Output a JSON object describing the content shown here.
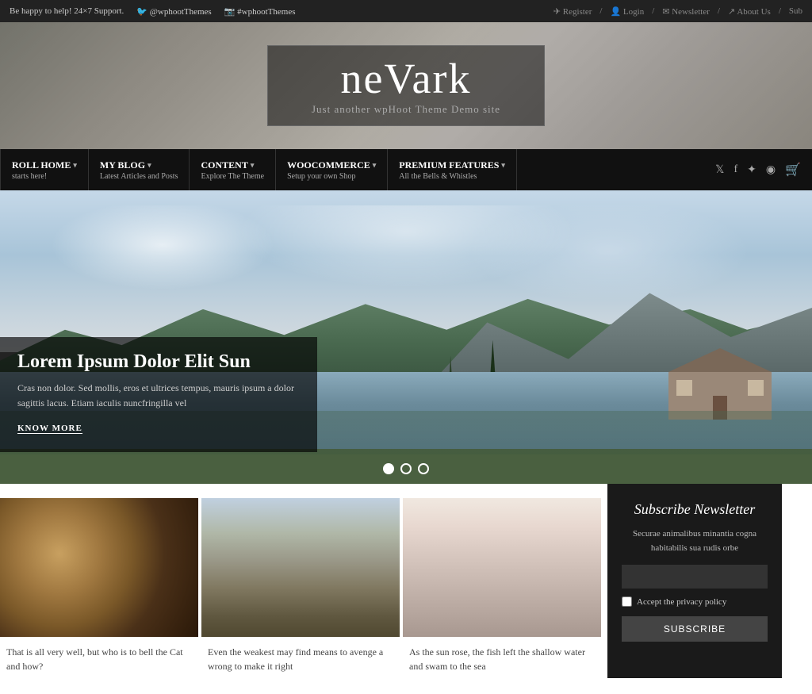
{
  "topbar": {
    "support_text": "Be happy to help! 24×7 Support.",
    "twitter_handle": "@wphootThemes",
    "instagram_handle": "#wphootThemes",
    "register": "Register",
    "login": "Login",
    "newsletter": "Newsletter",
    "about_us": "About Us",
    "subscribe": "Sub"
  },
  "header": {
    "logo": "neVark",
    "tagline": "Just another wpHoot Theme Demo site"
  },
  "nav": {
    "items": [
      {
        "label": "ROLL HOME",
        "sub": "starts here!",
        "has_arrow": true
      },
      {
        "label": "MY BLOG",
        "sub": "Latest Articles and Posts",
        "has_arrow": true
      },
      {
        "label": "CONTENT",
        "sub": "Explore The Theme",
        "has_arrow": true
      },
      {
        "label": "WOOCOMMERCE",
        "sub": "Setup your own Shop",
        "has_arrow": true
      },
      {
        "label": "PREMIUM FEATURES",
        "sub": "All the Bells & Whistles",
        "has_arrow": true
      }
    ]
  },
  "hero": {
    "title": "Lorem Ipsum Dolor Elit Sun",
    "description": "Cras non dolor. Sed mollis, eros et ultrices tempus, mauris ipsum a dolor sagittis lacus. Etiam iaculis nuncfringilla vel",
    "cta": "KNOW MORE",
    "dots": [
      {
        "active": true
      },
      {
        "active": false
      },
      {
        "active": false
      }
    ]
  },
  "cards": [
    {
      "text": "That is all very well, but who is to bell the Cat and how?"
    },
    {
      "text": "Even the weakest may find means to avenge a wrong to make it right"
    },
    {
      "text": "As the sun rose, the fish left the shallow water and swam to the sea"
    }
  ],
  "newsletter": {
    "title": "Subscribe Newsletter",
    "description": "Securae animalibus minantia cogna habitabilis sua rudis orbe",
    "input_placeholder": "",
    "checkbox_label": "Accept the privacy policy",
    "button_label": "SUBSCRIBE"
  },
  "social": {
    "twitter": "𝕏",
    "facebook": "f",
    "pinterest": "P",
    "tripadvisor": "✈",
    "cart": "🛒"
  }
}
